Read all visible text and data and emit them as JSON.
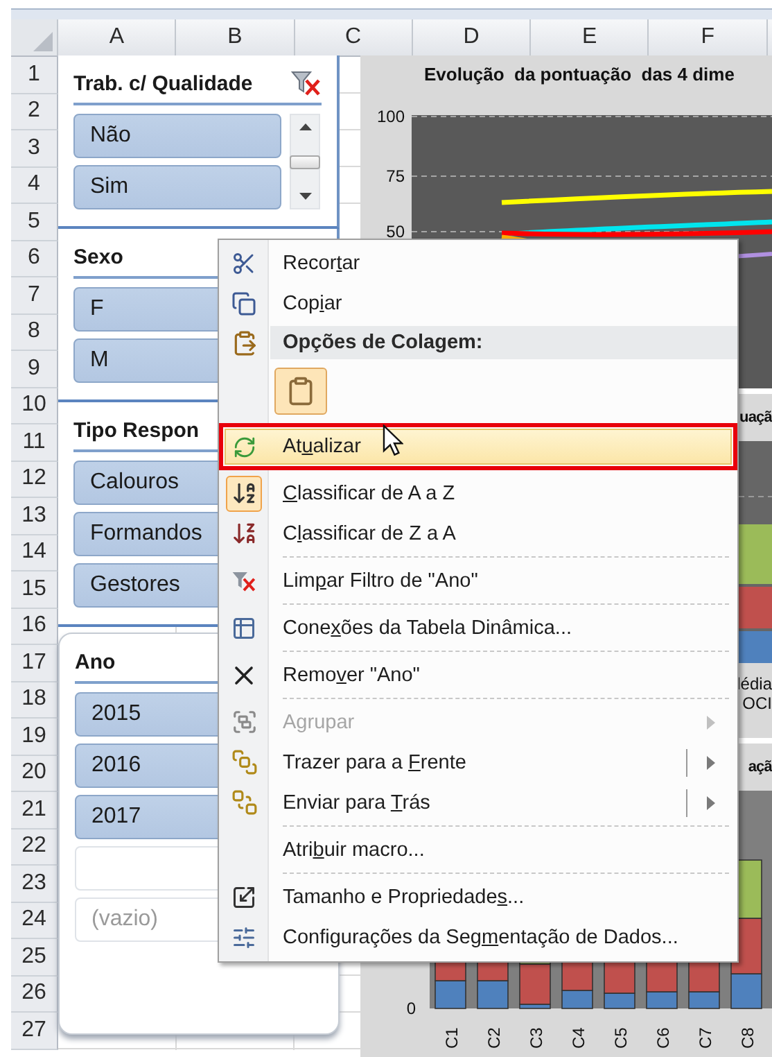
{
  "column_headers": [
    "A",
    "B",
    "C",
    "D",
    "E",
    "F"
  ],
  "row_headers": [
    "1",
    "2",
    "3",
    "4",
    "5",
    "6",
    "7",
    "8",
    "9",
    "10",
    "11",
    "12",
    "13",
    "14",
    "15",
    "16",
    "17",
    "18",
    "19",
    "20",
    "21",
    "22",
    "23",
    "24",
    "25",
    "26",
    "27"
  ],
  "slicers": [
    {
      "title": "Trab. c/ Qualidade",
      "kind": "panel",
      "filtered": true,
      "scrollable": true,
      "items": [
        {
          "label": "Não",
          "selected": true,
          "has_data": true
        },
        {
          "label": "Sim",
          "selected": true,
          "has_data": true
        }
      ]
    },
    {
      "title": "Sexo",
      "kind": "panel",
      "items": [
        {
          "label": "F",
          "selected": true,
          "has_data": true
        },
        {
          "label": "M",
          "selected": true,
          "has_data": true
        }
      ]
    },
    {
      "title": "Tipo Respon",
      "kind": "panel",
      "items": [
        {
          "label": "Calouros",
          "selected": true,
          "has_data": true
        },
        {
          "label": "Formandos",
          "selected": true,
          "has_data": true
        },
        {
          "label": "Gestores",
          "selected": true,
          "has_data": true
        }
      ]
    },
    {
      "title": "Ano",
      "kind": "card",
      "items": [
        {
          "label": "2015",
          "selected": true,
          "has_data": true
        },
        {
          "label": "2016",
          "selected": true,
          "has_data": true
        },
        {
          "label": "2017",
          "selected": true,
          "has_data": true
        },
        {
          "selected": false
        },
        {
          "label": "(vazio)",
          "selected": false,
          "has_data": false
        }
      ]
    }
  ],
  "charts": [
    {
      "kind": "lines",
      "title": "Evolução  da pontuação  das 4 dime",
      "y_ticks": [
        "100",
        "75",
        "50"
      ]
    },
    {
      "kind": "legend",
      "title": "uaçã",
      "legend": [
        "lédia",
        "OCI"
      ]
    },
    {
      "kind": "bars",
      "title": "açã",
      "y_ticks": [
        "0"
      ],
      "categories": [
        "C1",
        "C2",
        "C3",
        "C4",
        "C5",
        "C6",
        "C7",
        "C8"
      ]
    }
  ],
  "menu": {
    "items": [
      {
        "kind": "item",
        "label": {
          "pre": "Recor",
          "key": "t",
          "post": "ar"
        },
        "selected": false,
        "outlined": false,
        "checked": false,
        "disabled": false
      },
      {
        "kind": "item",
        "label": {
          "pre": "Cop",
          "key": "i",
          "post": "ar"
        },
        "selected": false,
        "outlined": false,
        "checked": false,
        "disabled": false
      },
      {
        "kind": "header",
        "label": "Opções de Colagem:"
      },
      {
        "kind": "paste"
      },
      {
        "kind": "item",
        "label": {
          "pre": "At",
          "key": "u",
          "post": "alizar"
        },
        "selected": true,
        "outlined": true,
        "checked": false,
        "disabled": false
      },
      {
        "kind": "item",
        "label": {
          "key": "C",
          "post": "lassificar de A a Z"
        },
        "selected": false,
        "outlined": false,
        "checked": true,
        "disabled": false
      },
      {
        "kind": "item",
        "label": {
          "pre": "C",
          "key": "l",
          "post": "assificar de Z a A"
        },
        "selected": false,
        "outlined": false,
        "checked": false,
        "disabled": false
      },
      {
        "kind": "separator"
      },
      {
        "kind": "item",
        "label": {
          "pre": "Lim",
          "key": "p",
          "post": "ar Filtro de \"Ano\""
        },
        "selected": false,
        "outlined": false,
        "checked": false,
        "disabled": false
      },
      {
        "kind": "separator"
      },
      {
        "kind": "item",
        "label": {
          "pre": "Cone",
          "key": "x",
          "post": "ões da Tabela Dinâmica..."
        },
        "selected": false,
        "outlined": false,
        "checked": false,
        "disabled": false
      },
      {
        "kind": "separator"
      },
      {
        "kind": "item",
        "label": {
          "pre": "Remo",
          "key": "v",
          "post": "er \"Ano\""
        },
        "selected": false,
        "outlined": false,
        "checked": false,
        "disabled": false
      },
      {
        "kind": "separator"
      },
      {
        "kind": "item",
        "label": {
          "pre": "A",
          "key": "g",
          "post": "rupar"
        },
        "selected": false,
        "outlined": false,
        "checked": false,
        "disabled": true,
        "submenu": true,
        "split": false
      },
      {
        "kind": "item",
        "label": {
          "pre": "Trazer para a ",
          "key": "F",
          "post": "rente"
        },
        "selected": false,
        "outlined": false,
        "checked": false,
        "disabled": false,
        "submenu": true,
        "split": true
      },
      {
        "kind": "item",
        "label": {
          "pre": "Enviar para ",
          "key": "T",
          "post": "rás"
        },
        "selected": false,
        "outlined": false,
        "checked": false,
        "disabled": false,
        "submenu": true,
        "split": true
      },
      {
        "kind": "separator"
      },
      {
        "kind": "item",
        "label": {
          "pre": "Atri",
          "key": "b",
          "post": "uir macro..."
        },
        "selected": false,
        "outlined": false,
        "checked": false,
        "disabled": false
      },
      {
        "kind": "separator"
      },
      {
        "kind": "item",
        "label": {
          "pre": "Tamanho e Propriedade",
          "key": "s",
          "post": "..."
        },
        "selected": false,
        "outlined": false,
        "checked": false,
        "disabled": false
      },
      {
        "kind": "item",
        "label": {
          "pre": "Configurações da Seg",
          "key": "m",
          "post": "entação de Dados..."
        },
        "selected": false,
        "outlined": false,
        "checked": false,
        "disabled": false
      }
    ]
  }
}
